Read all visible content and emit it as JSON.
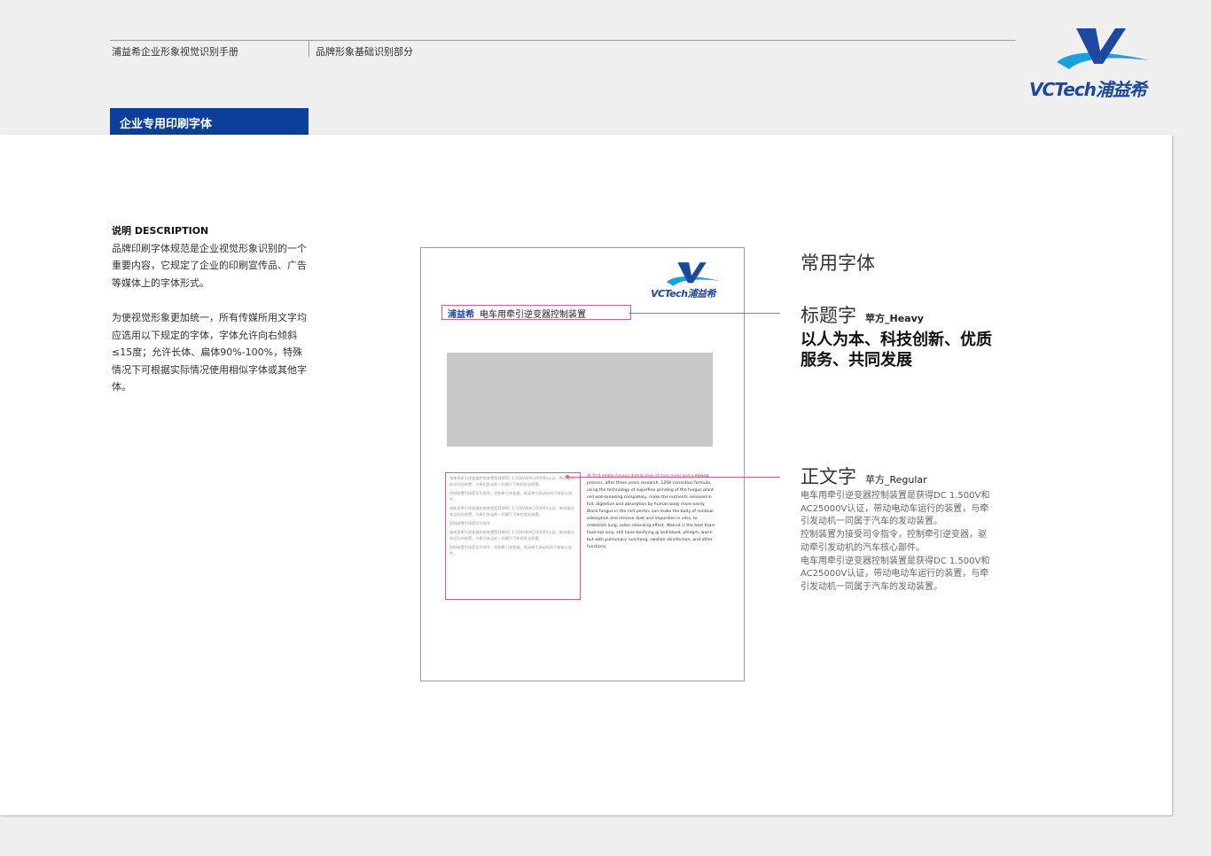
{
  "header": {
    "manual_title": "浦益希企业形象视觉识别手册",
    "section_title": "品牌形象基础识别部分"
  },
  "logo": {
    "text": "VCTech浦益希",
    "mark": "V"
  },
  "section_tab": "企业专用印刷字体",
  "description": {
    "title": "说明 DESCRIPTION",
    "paragraph1": "品牌印刷字体规范是企业视觉形象识别的一个重要内容，它规定了企业的印刷宣传品、广告等媒体上的字体形式。",
    "paragraph2": "为使视觉形象更加统一，所有传媒所用文字均应选用以下规定的字体，字体允许向右倾斜≤15度；允许长体、扁体90%-100%，特殊情况下可根据实际情况使用相似字体或其他字体。"
  },
  "mock_page": {
    "logo_text": "VCTech浦益希",
    "title_brand": "浦益希",
    "title_text": "电车用牵引逆变器控制装置",
    "body_cn": [
      "电车用牵引逆变器控制装置是获得DC 1.500V和AC25000V认证，带动电动车运行的装置，与牵引发动机一同属于汽车的发动装置。",
      "控制装置为接受司令指令，控制牵引逆变器，驱动牵引发动机的汽车核心部件。",
      "电车用牵引逆变器控制装置是获得DC 1.500V和AC25000V认证，带动电动车运行的装置，与牵引发动机一同属于汽车的发动装置。",
      "控制装置为接受司令指令",
      "电车用牵引逆变器控制装置是获得DC 1.500V和AC25000V认证，带动电动车运行的装置，与牵引发动机一同属于汽车的发动装置。",
      "控制装置为接受司令指令，控制牵引逆变器，驱动牵引发动机的汽车核心部件。"
    ],
    "body_en_highlight": "At first edible fungus distribution of corn meal and a",
    "body_en": "mixing process, after three years research, 1268 correction formula, using the technology of superfine grinding of the fungus plant cell wall-breaking completely, make the nutrients released in full, digestion and absorption by human body more easily. Black fungus in the rich pectin, can make the body of residual adsorption and remove dust and impurities in vitro, to embellish lung, colon cleansing effect. Walnut is the best brain food not only, still have tonifying qi and blood, phlegm, warm but with pulmonary runchang, swollen disinfection, and other functions."
  },
  "fonts": {
    "heading": "常用字体",
    "title_font": {
      "label": "标题字",
      "name": "苹方_Heavy",
      "sample": "以人为本、科技创新、优质服务、共同发展"
    },
    "body_font": {
      "label": "正文字",
      "name": "苹方_Regular",
      "sample_lines": [
        "电车用牵引逆变器控制装置是获得DC 1.500V和AC25000V认证，带动电动车运行的装置，与牵引发动机一同属于汽车的发动装置。",
        "控制装置为接受司令指令，控制牵引逆变器，驱动牵引发动机的汽车核心部件。",
        "电车用牵引逆变器控制装置是获得DC 1.500V和AC25000V认证，带动电动车运行的装置，与牵引发动机一同属于汽车的发动装置。"
      ]
    }
  },
  "colors": {
    "brand_blue": "#0b3f9a",
    "annotation_pink": "#e05a86",
    "placeholder_gray": "#c8c8c8"
  }
}
